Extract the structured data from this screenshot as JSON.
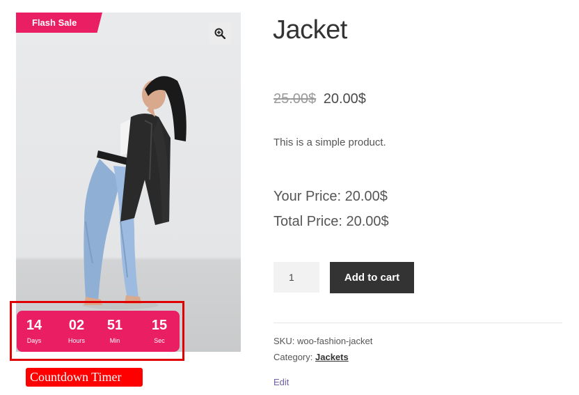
{
  "badge": {
    "label": "Flash Sale",
    "color": "#e91e63"
  },
  "zoom": {
    "icon": "magnifier-plus-icon"
  },
  "countdown": {
    "units": [
      {
        "value": "14",
        "label": "Days"
      },
      {
        "value": "02",
        "label": "Hours"
      },
      {
        "value": "51",
        "label": "Min"
      },
      {
        "value": "15",
        "label": "Sec"
      }
    ],
    "color": "#e91e63"
  },
  "annotation": {
    "label": "Countdown Timer",
    "color": "#ff0000"
  },
  "product": {
    "title": "Jacket",
    "old_price": "25.00$",
    "new_price": "20.00$",
    "description": "This is a simple product.",
    "your_price": "Your Price: 20.00$",
    "total_price": "Total Price: 20.00$",
    "quantity": "1",
    "add_to_cart": "Add to cart",
    "sku": "SKU: woo-fashion-jacket",
    "category_label": "Category:",
    "category_value": "Jackets",
    "edit": "Edit"
  }
}
